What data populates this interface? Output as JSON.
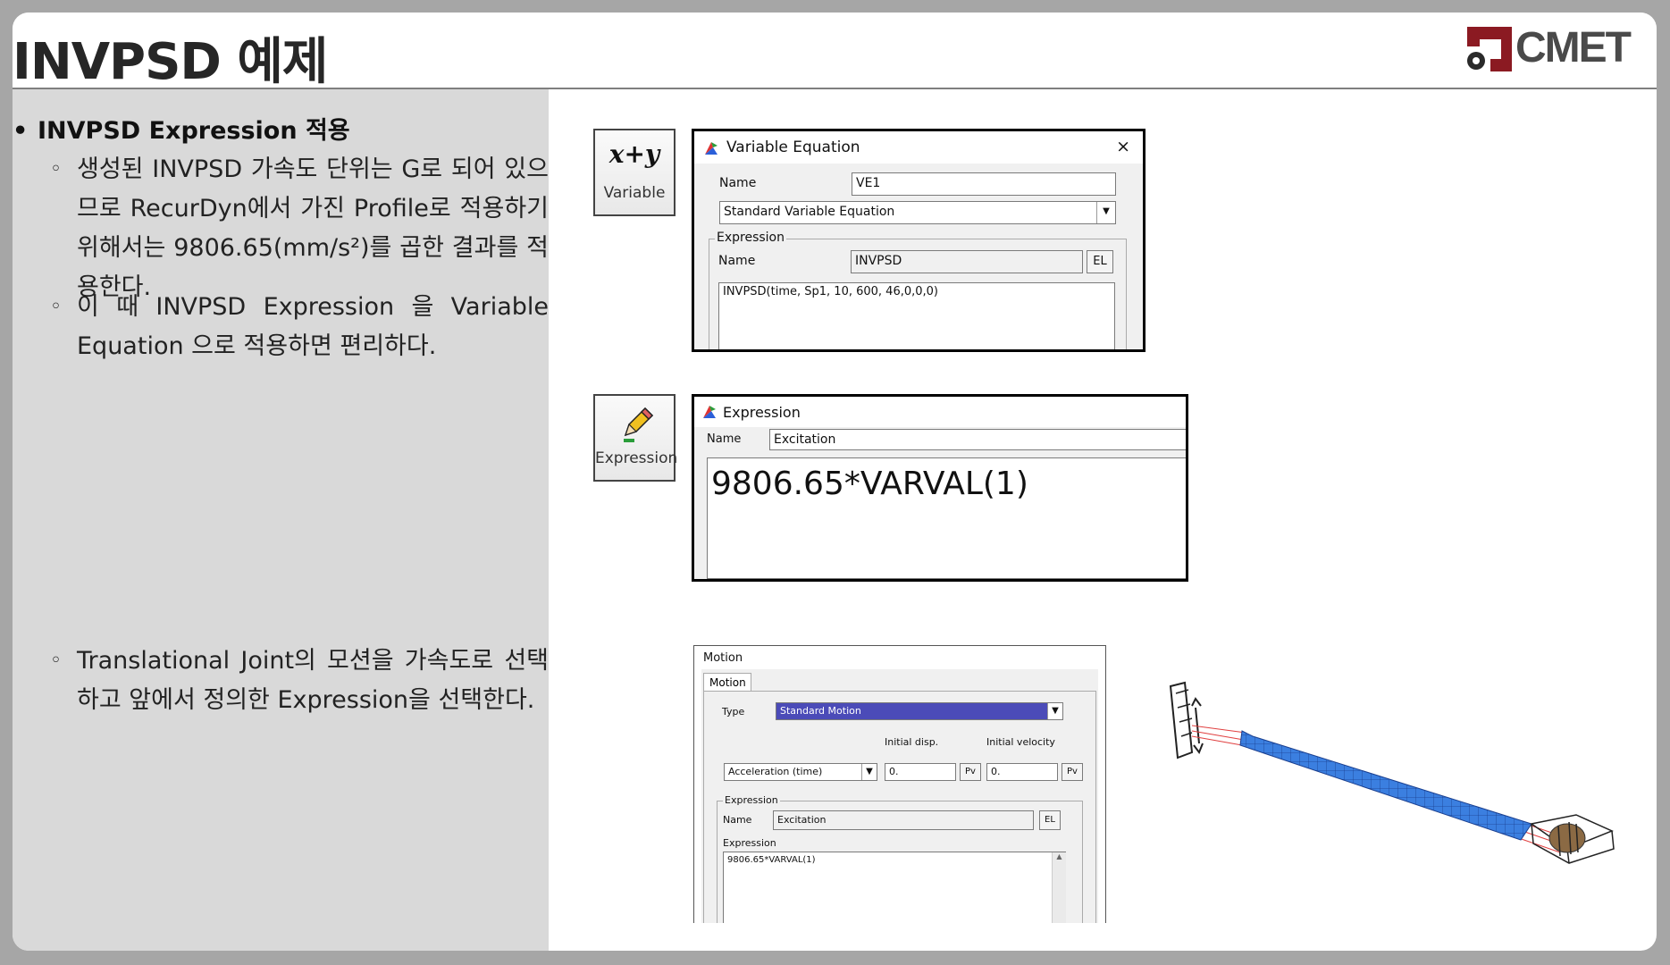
{
  "slide": {
    "title": "INVPSD 예제",
    "logo_text": "CMET",
    "colors": {
      "logo_red": "#8b1a22",
      "left_panel_bg": "#d9d9d9",
      "mesh_blue": "#3b7fe0"
    }
  },
  "left": {
    "bullet_main": "INVPSD Expression 적용",
    "sub_mark": "◦",
    "sub1": "생성된 INVPSD 가속도 단위는 G로 되어 있으므로 RecurDyn에서 가진 Profile로 적용하기 위해서는 9806.65(mm/s²)를 곱한 결과를 적용한다.",
    "sub2": "이 때 INVPSD Expression 을 Variable Equation 으로 적용하면 편리하다.",
    "sub3": "Translational Joint의 모션을 가속도로 선택하고 앞에서 정의한 Expression을 선택한다."
  },
  "icons": {
    "variable_symbol": "x+y",
    "variable_label": "Variable",
    "expression_label": "Expression"
  },
  "variable_dialog": {
    "title": "Variable Equation",
    "close": "×",
    "name_label": "Name",
    "name_value": "VE1",
    "type_value": "Standard Variable Equation",
    "group_label": "Expression",
    "expr_name_label": "Name",
    "expr_name_value": "INVPSD",
    "el_button": "EL",
    "expression_text": "INVPSD(time, Sp1, 10, 600, 46,0,0,0)"
  },
  "expression_dialog": {
    "title": "Expression",
    "name_label": "Name",
    "name_value": "Excitation",
    "expression_text": "9806.65*VARVAL(1)"
  },
  "motion_dialog": {
    "title": "Motion",
    "tab": "Motion",
    "type_label": "Type",
    "type_value": "Standard Motion",
    "init_disp_label": "Initial disp.",
    "init_vel_label": "Initial velocity",
    "mode_value": "Acceleration (time)",
    "init_disp_value": "0.",
    "init_vel_value": "0.",
    "pv_button": "Pv",
    "group_label": "Expression",
    "name_label": "Name",
    "name_value": "Excitation",
    "el_button": "EL",
    "expression_label": "Expression",
    "expression_text": "9806.65*VARVAL(1)"
  }
}
